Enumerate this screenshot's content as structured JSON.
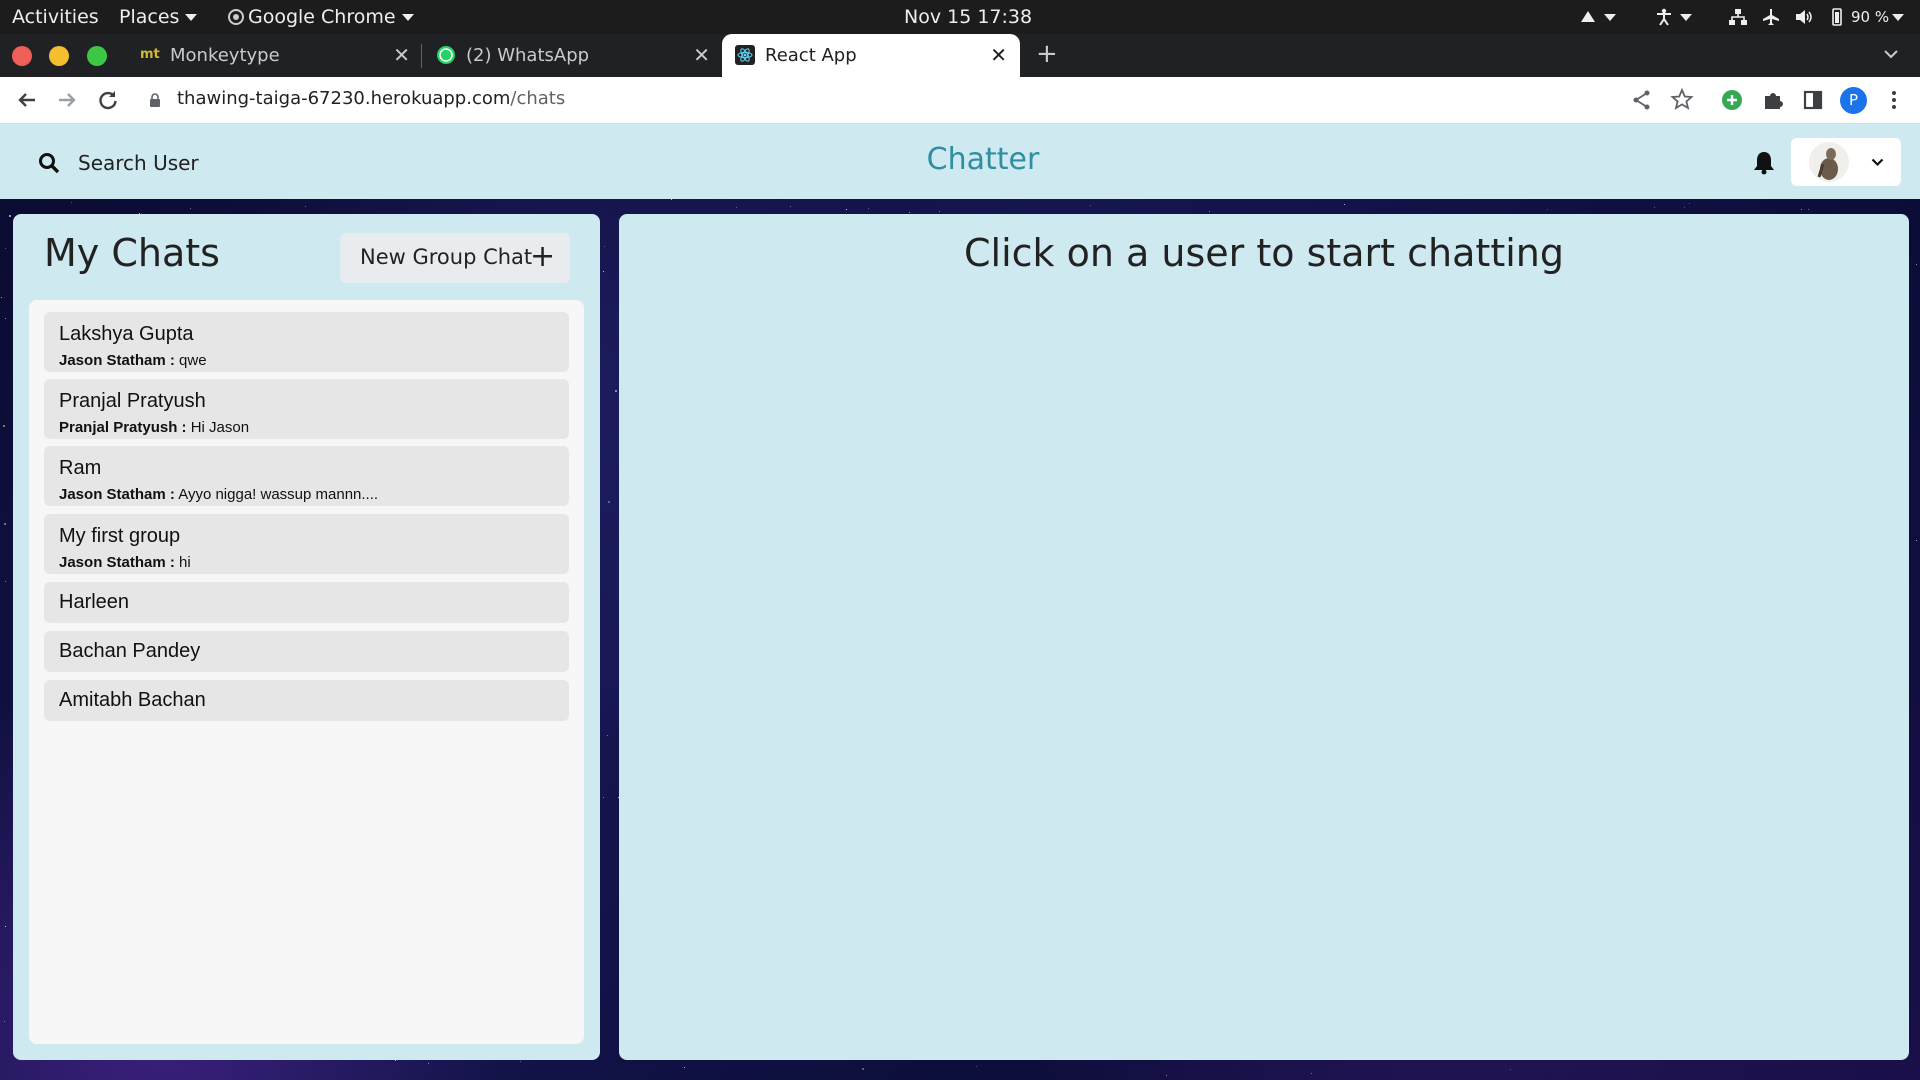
{
  "system_bar": {
    "activities": "Activities",
    "places": "Places",
    "app_name": "Google Chrome",
    "clock": "Nov 15  17:38",
    "battery": "90 %"
  },
  "browser": {
    "tabs": [
      {
        "title": "Monkeytype",
        "icon": "monkeytype-icon",
        "favicon_text": "mt"
      },
      {
        "title": "(2) WhatsApp",
        "icon": "whatsapp-icon"
      },
      {
        "title": "React App",
        "icon": "react-icon",
        "active": true
      }
    ],
    "url_host": "thawing-taiga-67230.herokuapp.com",
    "url_path": "/chats",
    "profile_initial": "P"
  },
  "header": {
    "search_label": "Search User",
    "brand": "Chatter"
  },
  "chats_panel": {
    "title": "My Chats",
    "new_group_label": "New Group Chat",
    "chats": [
      {
        "name": "Lakshya Gupta",
        "sender": "Jason Statham :",
        "message": "qwe"
      },
      {
        "name": "Pranjal Pratyush",
        "sender": "Pranjal Pratyush :",
        "message": "Hi Jason"
      },
      {
        "name": "Ram",
        "sender": "Jason Statham :",
        "message": "Ayyo nigga! wassup mannn...."
      },
      {
        "name": "My first group",
        "sender": "Jason Statham :",
        "message": "hi"
      },
      {
        "name": "Harleen"
      },
      {
        "name": "Bachan Pandey"
      },
      {
        "name": "Amitabh Bachan"
      }
    ]
  },
  "chat_area": {
    "empty_message": "Click on a user to start chatting"
  },
  "colors": {
    "panel_bg": "#cfe9f1",
    "brand": "#2f8ea0",
    "chat_item_bg": "#e6e6e6",
    "list_bg": "#f7f7f7"
  }
}
